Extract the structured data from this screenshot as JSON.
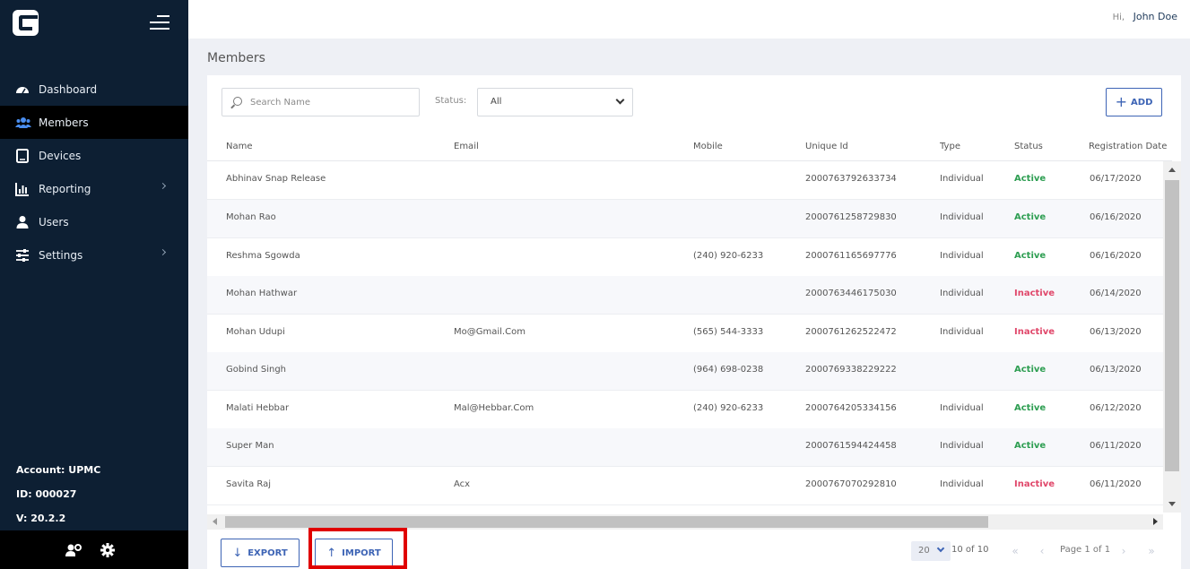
{
  "header": {
    "greeting": "Hi,",
    "user_name": "John Doe"
  },
  "sidebar": {
    "nav": [
      {
        "label": "Dashboard",
        "icon": "dashboard-icon"
      },
      {
        "label": "Members",
        "icon": "members-icon",
        "active": true
      },
      {
        "label": "Devices",
        "icon": "devices-icon"
      },
      {
        "label": "Reporting",
        "icon": "reporting-icon",
        "has_submenu": true
      },
      {
        "label": "Users",
        "icon": "user-icon"
      },
      {
        "label": "Settings",
        "icon": "settings-sliders-icon",
        "has_submenu": true
      }
    ],
    "account": "Account: UPMC",
    "id": "ID: 000027",
    "version": "V: 20.2.2",
    "bottom_icons": [
      "user-settings-icon",
      "gear-icon"
    ]
  },
  "page": {
    "title": "Members"
  },
  "filters": {
    "search_placeholder": "Search Name",
    "status_label": "Status:",
    "status_value": "All"
  },
  "toolbar": {
    "add_label": "ADD",
    "export_label": "EXPORT",
    "import_label": "IMPORT"
  },
  "table": {
    "columns": [
      "Name",
      "Email",
      "Mobile",
      "Unique Id",
      "Type",
      "Status",
      "Registration Date"
    ],
    "rows": [
      {
        "name": "Abhinav Snap Release",
        "email": "",
        "mobile": "",
        "unique_id": "2000763792633734",
        "type": "Individual",
        "status": "Active",
        "date": "06/17/2020"
      },
      {
        "name": "Mohan Rao",
        "email": "",
        "mobile": "",
        "unique_id": "2000761258729830",
        "type": "Individual",
        "status": "Active",
        "date": "06/16/2020"
      },
      {
        "name": "Reshma Sgowda",
        "email": "",
        "mobile": "(240) 920-6233",
        "unique_id": "2000761165697776",
        "type": "Individual",
        "status": "Active",
        "date": "06/16/2020"
      },
      {
        "name": "Mohan Hathwar",
        "email": "",
        "mobile": "",
        "unique_id": "2000763446175030",
        "type": "Individual",
        "status": "Inactive",
        "date": "06/14/2020"
      },
      {
        "name": "Mohan Udupi",
        "email": "Mo@Gmail.Com",
        "mobile": "(565) 544-3333",
        "unique_id": "2000761262522472",
        "type": "Individual",
        "status": "Inactive",
        "date": "06/13/2020"
      },
      {
        "name": "Gobind Singh",
        "email": "",
        "mobile": "(964) 698-0238",
        "unique_id": "2000769338229222",
        "type": "",
        "status": "Active",
        "date": "06/13/2020"
      },
      {
        "name": "Malati Hebbar",
        "email": "Mal@Hebbar.Com",
        "mobile": "(240) 920-6233",
        "unique_id": "2000764205334156",
        "type": "Individual",
        "status": "Active",
        "date": "06/12/2020"
      },
      {
        "name": "Super Man",
        "email": "",
        "mobile": "",
        "unique_id": "2000761594424458",
        "type": "Individual",
        "status": "Active",
        "date": "06/11/2020"
      },
      {
        "name": "Savita Raj",
        "email": "Acx",
        "mobile": "",
        "unique_id": "2000767070292810",
        "type": "Individual",
        "status": "Inactive",
        "date": "06/11/2020"
      }
    ]
  },
  "pagination": {
    "page_size": "20",
    "range": "10 of 10",
    "page_text": "Page 1 of 1"
  },
  "colors": {
    "sidebar_bg": "#0d1f33",
    "accent": "#3d64b5",
    "active": "#2e9e52",
    "inactive": "#e0476a",
    "highlight": "#e00000"
  }
}
